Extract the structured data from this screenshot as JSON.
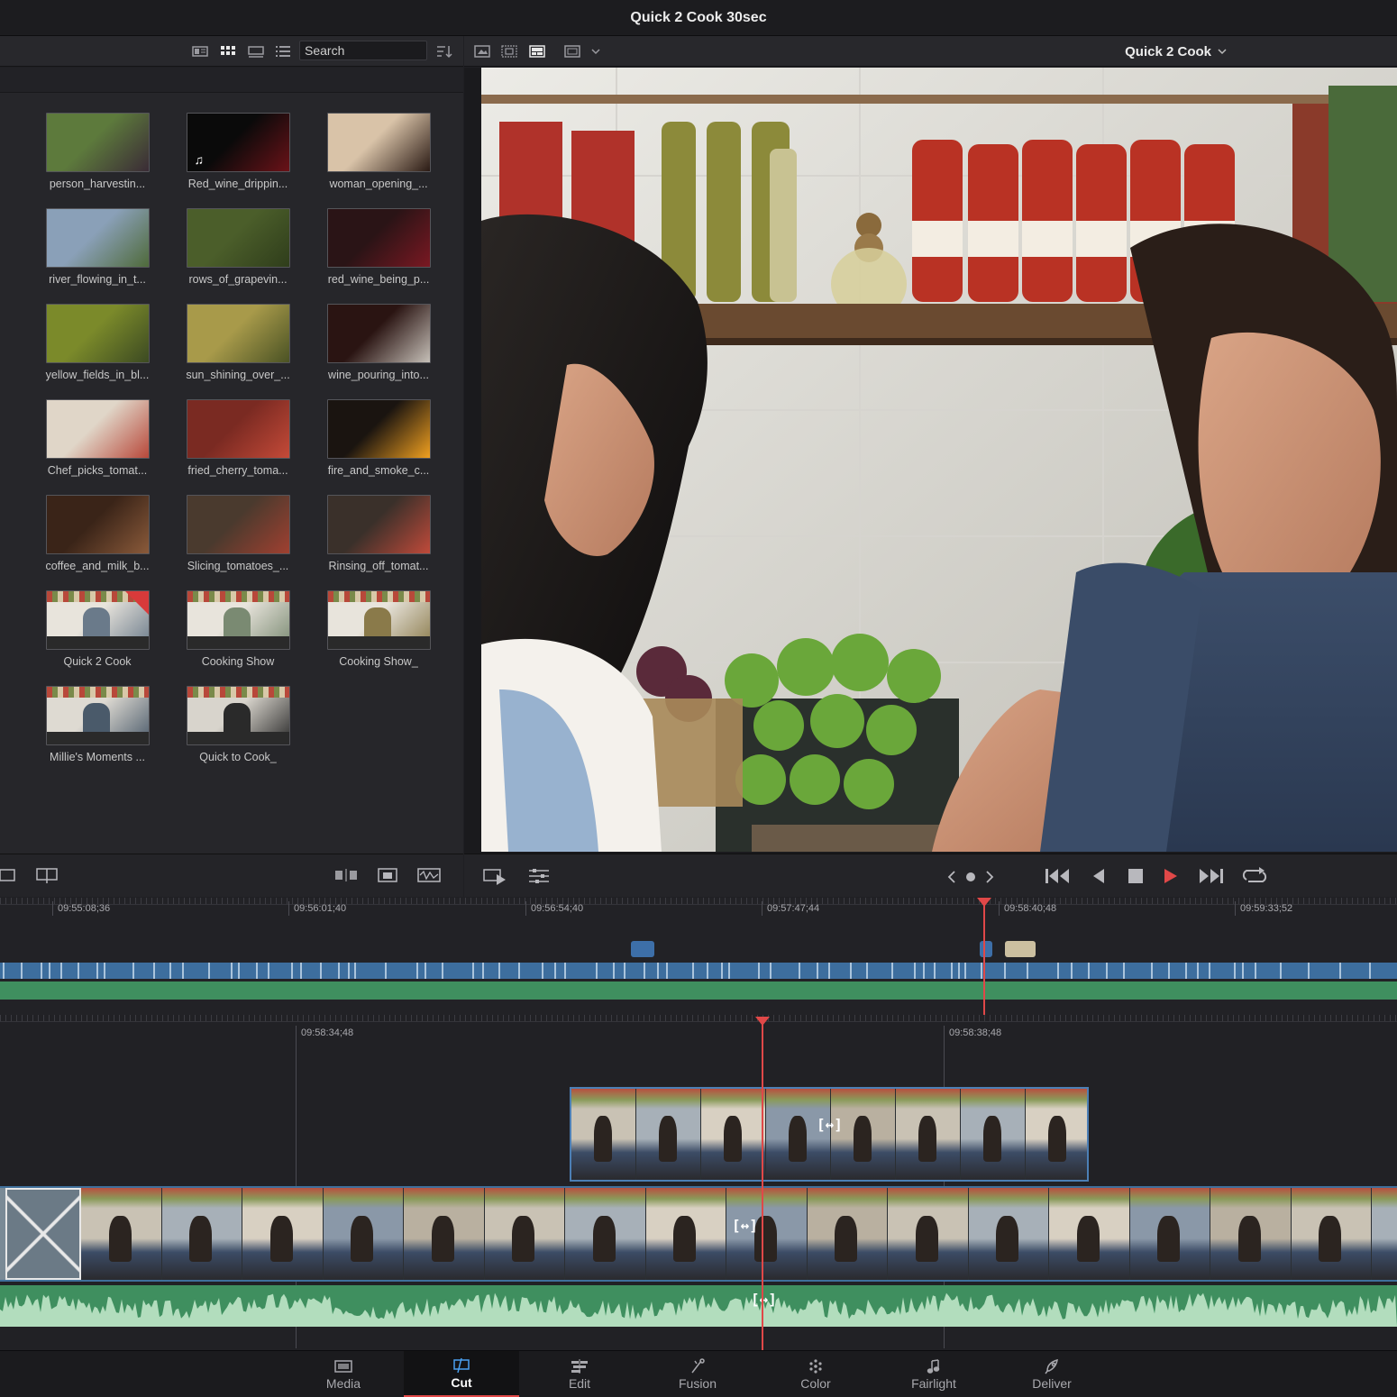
{
  "window": {
    "title": "Quick 2 Cook 30sec"
  },
  "media_toolbar": {
    "search_placeholder": "Search",
    "icons": [
      "metadata-view-icon",
      "thumbnail-view-icon",
      "filmstrip-view-icon",
      "list-view-icon",
      "sort-icon"
    ]
  },
  "viewer": {
    "clip_name": "Quick 2 Cook",
    "selected_clip": "Quick 2 Cook"
  },
  "media_pool": {
    "clips": [
      {
        "name": "person_harvestin...",
        "type": "video",
        "c1": "#5d7a3c",
        "c2": "#3a2b36"
      },
      {
        "name": "Red_wine_drippin...",
        "type": "audio",
        "c1": "#0a0a0a",
        "c2": "#6b1218"
      },
      {
        "name": "woman_opening_...",
        "type": "video",
        "c1": "#d9c3a8",
        "c2": "#2a1a14"
      },
      {
        "name": "river_flowing_in_t...",
        "type": "video",
        "c1": "#8aa0b8",
        "c2": "#4f6a3a"
      },
      {
        "name": "rows_of_grapevin...",
        "type": "video",
        "c1": "#4b5e2a",
        "c2": "#2f3d1b"
      },
      {
        "name": "red_wine_being_p...",
        "type": "video",
        "c1": "#2a1416",
        "c2": "#7a1822"
      },
      {
        "name": "yellow_fields_in_bl...",
        "type": "video",
        "c1": "#7b8a2a",
        "c2": "#3c4a22"
      },
      {
        "name": "sun_shining_over_...",
        "type": "video",
        "c1": "#a89a4a",
        "c2": "#4a5224"
      },
      {
        "name": "wine_pouring_into...",
        "type": "video",
        "c1": "#2a1412",
        "c2": "#c6c0b8"
      },
      {
        "name": "Chef_picks_tomat...",
        "type": "video",
        "c1": "#e0d6c8",
        "c2": "#b8483a"
      },
      {
        "name": "fried_cherry_toma...",
        "type": "video",
        "c1": "#7a2a22",
        "c2": "#c44a38"
      },
      {
        "name": "fire_and_smoke_c...",
        "type": "video",
        "c1": "#1a1410",
        "c2": "#f0a020"
      },
      {
        "name": "coffee_and_milk_b...",
        "type": "video",
        "c1": "#3a2418",
        "c2": "#8a5a3a"
      },
      {
        "name": "Slicing_tomatoes_...",
        "type": "video",
        "c1": "#4a3a2e",
        "c2": "#a04030"
      },
      {
        "name": "Rinsing_off_tomat...",
        "type": "video",
        "c1": "#3a302a",
        "c2": "#c04a3a"
      },
      {
        "name": "Quick 2 Cook",
        "type": "timeline",
        "selected": true,
        "c1": "#e8e4dc",
        "c2": "#6a7a8a"
      },
      {
        "name": "Cooking Show",
        "type": "timeline",
        "c1": "#e8e4dc",
        "c2": "#7a8a72"
      },
      {
        "name": "Cooking Show_",
        "type": "timeline",
        "c1": "#e8e4dc",
        "c2": "#8a7a4a"
      },
      {
        "name": "Millie's Moments ...",
        "type": "timeline",
        "c1": "#dedad2",
        "c2": "#4a5a6a"
      },
      {
        "name": "Quick to Cook_",
        "type": "timeline",
        "c1": "#d8d4cc",
        "c2": "#2a2a2a"
      }
    ]
  },
  "upper_timeline": {
    "timecodes": [
      "09:55:08;36",
      "09:56:01;40",
      "09:56:54;40",
      "09:57:47;44",
      "09:58:40;48",
      "09:59:33;52"
    ]
  },
  "lower_timeline": {
    "timecodes": [
      "09:58:34;48",
      "09:58:38;48"
    ]
  },
  "page_nav": [
    {
      "label": "Media",
      "icon": "media-page-icon"
    },
    {
      "label": "Cut",
      "icon": "cut-page-icon",
      "active": true
    },
    {
      "label": "Edit",
      "icon": "edit-page-icon"
    },
    {
      "label": "Fusion",
      "icon": "fusion-page-icon"
    },
    {
      "label": "Color",
      "icon": "color-page-icon"
    },
    {
      "label": "Fairlight",
      "icon": "fairlight-page-icon"
    },
    {
      "label": "Deliver",
      "icon": "deliver-page-icon"
    }
  ],
  "colors": {
    "accent_red": "#e04848",
    "video_track": "#3d6e9e",
    "audio_track": "#3f8f5f"
  }
}
